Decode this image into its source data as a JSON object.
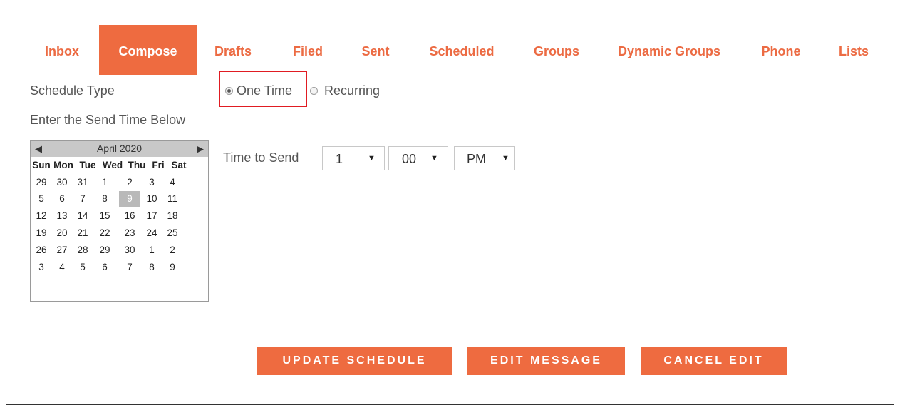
{
  "tabs": [
    {
      "label": "Inbox",
      "active": false
    },
    {
      "label": "Compose",
      "active": true
    },
    {
      "label": "Drafts",
      "active": false
    },
    {
      "label": "Filed",
      "active": false
    },
    {
      "label": "Sent",
      "active": false
    },
    {
      "label": "Scheduled",
      "active": false
    },
    {
      "label": "Groups",
      "active": false
    },
    {
      "label": "Dynamic Groups",
      "active": false
    },
    {
      "label": "Phone",
      "active": false
    },
    {
      "label": "Lists",
      "active": false
    }
  ],
  "schedule": {
    "type_label": "Schedule Type",
    "options": {
      "one_time": "One Time",
      "recurring": "Recurring"
    },
    "selected": "one_time",
    "send_time_label": "Enter the Send Time Below"
  },
  "calendar": {
    "month": "April 2020",
    "prev": "◀",
    "next": "▶",
    "weekdays": [
      "Sun",
      "Mon",
      "Tue",
      "Wed",
      "Thu",
      "Fri",
      "Sat"
    ],
    "weeks": [
      [
        "29",
        "30",
        "31",
        "1",
        "2",
        "3",
        "4"
      ],
      [
        "5",
        "6",
        "7",
        "8",
        "9",
        "10",
        "11"
      ],
      [
        "12",
        "13",
        "14",
        "15",
        "16",
        "17",
        "18"
      ],
      [
        "19",
        "20",
        "21",
        "22",
        "23",
        "24",
        "25"
      ],
      [
        "26",
        "27",
        "28",
        "29",
        "30",
        "1",
        "2"
      ],
      [
        "3",
        "4",
        "5",
        "6",
        "7",
        "8",
        "9"
      ]
    ],
    "selected_day": "9"
  },
  "time": {
    "label": "Time to Send",
    "hour": "1",
    "minute": "00",
    "ampm": "PM",
    "caret": "▼"
  },
  "buttons": {
    "update": "UPDATE SCHEDULE",
    "edit": "EDIT MESSAGE",
    "cancel": "CANCEL EDIT"
  },
  "colors": {
    "accent": "#ee6b40",
    "highlight": "#e01b22"
  }
}
